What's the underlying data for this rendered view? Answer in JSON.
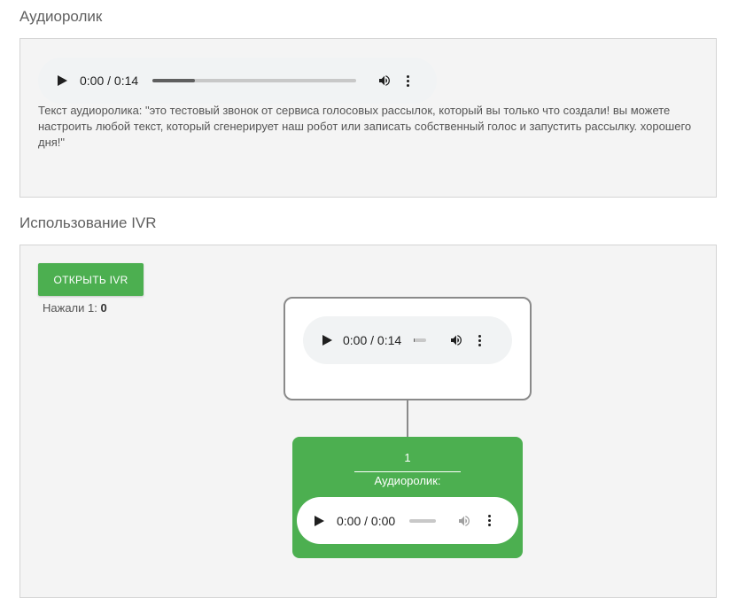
{
  "audio_section": {
    "title": "Аудиоролик",
    "player": {
      "time": "0:00 / 0:14",
      "progress": 0.21
    },
    "description": "Текст аудиоролика: \"это тестовый звонок от сервиса голосовых рассылок, который вы только что создали! вы можете настроить любой текст, который сгенерирует наш робот или записать собственный голос и запустить рассылку. хорошего дня!\""
  },
  "ivr_section": {
    "title": "Использование IVR",
    "open_button_label": "ОТКРЫТЬ IVR",
    "pressed_label": "Нажали 1:",
    "pressed_count": "0",
    "root_node": {
      "player": {
        "time": "0:00 / 0:14",
        "progress": 0.05
      }
    },
    "child_node": {
      "key": "1",
      "label": "Аудиоролик:",
      "player": {
        "time": "0:00 / 0:00",
        "progress": 0
      }
    }
  },
  "colors": {
    "accent_green": "#4caf50",
    "panel_bg": "#f4f4f4",
    "player_bg": "#f1f3f4"
  },
  "icons": [
    "play-icon",
    "volume-icon",
    "more-vert-icon"
  ]
}
